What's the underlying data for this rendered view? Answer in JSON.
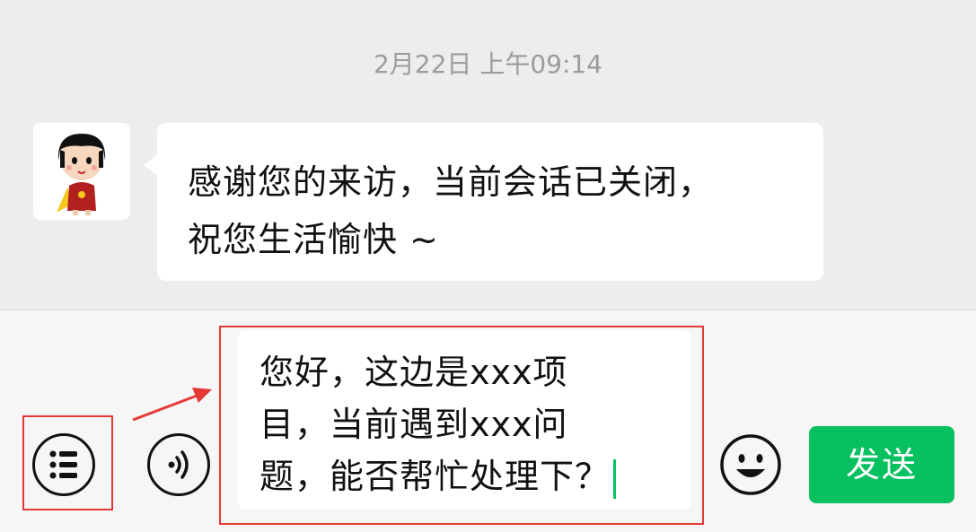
{
  "chat": {
    "timestamp": "2月22日 上午09:14",
    "message": {
      "line1": "感谢您的来访，当前会话已关闭，",
      "line2": "祝您生活愉快 ~"
    }
  },
  "input_bar": {
    "text_lines": [
      "您好，这边是xxx项",
      "目，当前遇到xxx问",
      "题，能否帮忙处理下？"
    ],
    "send_label": "发送",
    "icons": {
      "menu": "list-menu-icon",
      "voice": "voice-icon",
      "emoji": "emoji-icon"
    }
  },
  "colors": {
    "send_button": "#07c160",
    "annotation": "#e53935",
    "background": "#ededed"
  }
}
